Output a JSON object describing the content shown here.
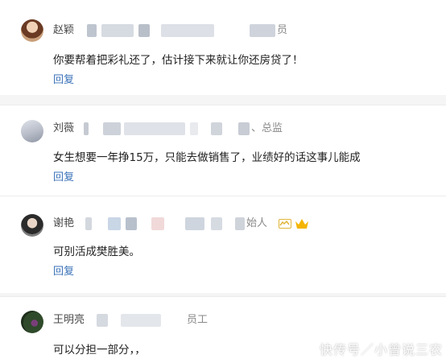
{
  "colors": {
    "name": "#4a4a4a",
    "reply": "#3a72b8",
    "text": "#222222",
    "title": "#8a8a8a"
  },
  "comments": [
    {
      "name": "赵颖",
      "title_tail": "员",
      "text": "你要帮着把彩礼还了，估计接下来就让你还房贷了！",
      "reply_label": "回复",
      "avatar_icon": "woman-avatar-icon"
    },
    {
      "name": "刘薇",
      "title_tail": "、总监",
      "text": "女生想要一年挣15万，只能去做销售了，业绩好的话这事儿能成",
      "reply_label": "回复",
      "avatar_icon": "portrait-avatar-icon"
    },
    {
      "name": "谢艳",
      "title_tail": "始人",
      "text": "可别活成樊胜美。",
      "reply_label": "回复",
      "avatar_icon": "woman-avatar-icon",
      "badges": [
        "vip-badge-icon",
        "crown-icon"
      ]
    },
    {
      "name": "王明亮",
      "title_tail": "员工",
      "text": "可以分担一部分，，",
      "reply_label": "",
      "avatar_icon": "plant-avatar-icon"
    }
  ],
  "watermark": "快传号／小曾说三农"
}
